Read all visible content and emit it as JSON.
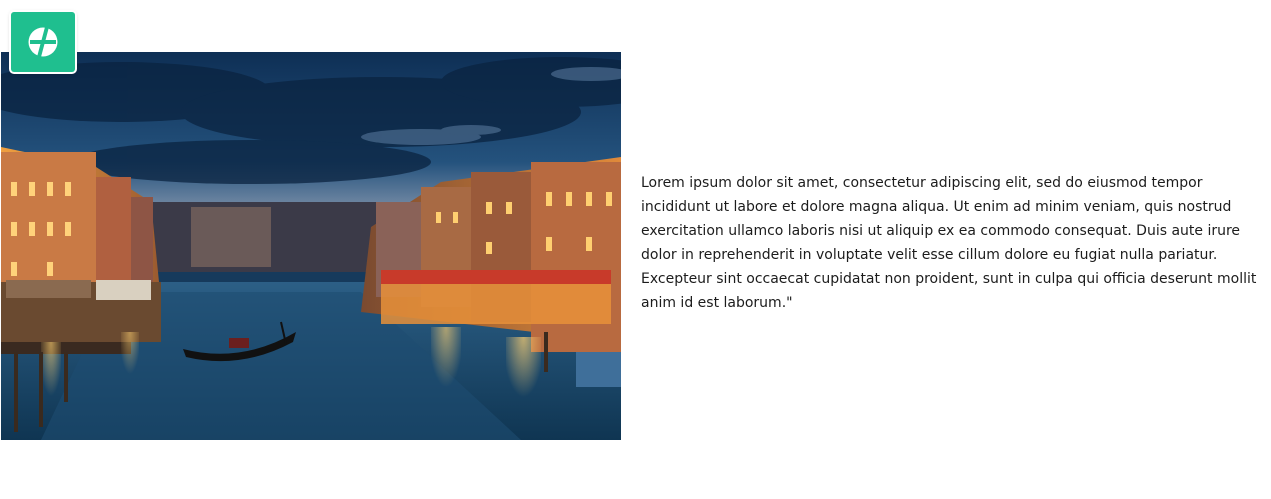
{
  "badge": {
    "icon": "circle-slash-logo-icon",
    "color": "#1fbf8f"
  },
  "photo": {
    "subject": "venice-grand-canal-dusk-image"
  },
  "content": {
    "paragraph": "Lorem ipsum dolor sit amet, consectetur adipiscing elit, sed do eiusmod tempor incididunt ut labore et dolore magna aliqua. Ut enim ad minim veniam, quis nostrud exercitation ullamco laboris nisi ut aliquip ex ea commodo consequat. Duis aute irure dolor in reprehenderit in voluptate velit esse cillum dolore eu fugiat nulla pariatur. Excepteur sint occaecat cupidatat non proident, sunt in culpa qui officia deserunt mollit anim id est laborum.\""
  }
}
